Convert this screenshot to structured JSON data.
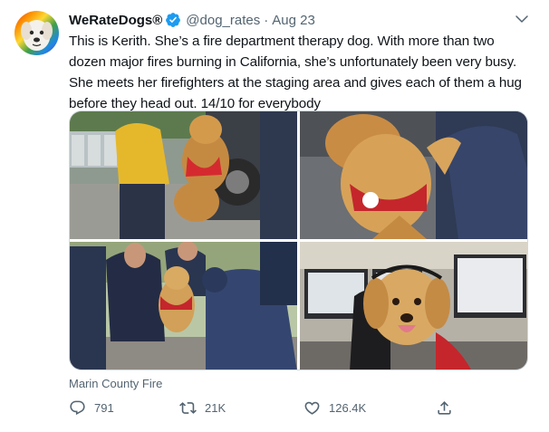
{
  "tweet": {
    "display_name": "WeRateDogs®",
    "handle": "@dog_rates",
    "separator": "·",
    "date": "Aug 23",
    "text": "This is Kerith. She’s a fire department therapy dog. With more than two dozen major fires burning in California, she’s unfortunately been very busy. She meets her firefighters at the staging area and gives each of them a hug before they head out. 14/10 for everybody",
    "source_label": "Marin County Fire",
    "media_count": 4,
    "stats": {
      "replies": "791",
      "retweets": "21K",
      "likes": "126.4K"
    }
  },
  "colors": {
    "verified_blue": "#1d9bf0",
    "muted_text": "#536471",
    "body_text": "#0f1419",
    "border": "#cfd9de"
  },
  "icons": [
    "avatar-dog",
    "verified-badge-icon",
    "chevron-down-icon",
    "reply-icon",
    "retweet-icon",
    "like-icon",
    "share-icon"
  ]
}
